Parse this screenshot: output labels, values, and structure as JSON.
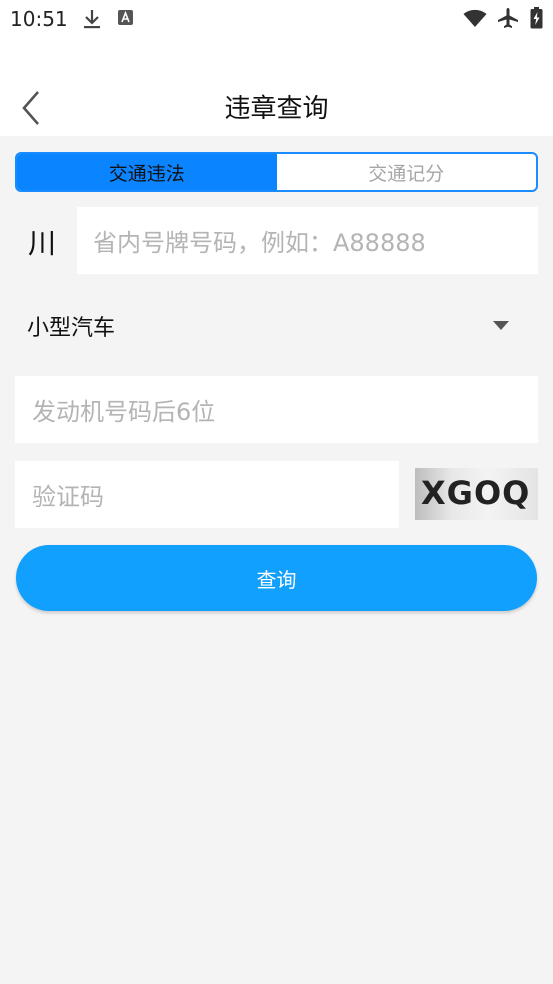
{
  "status_bar": {
    "time": "10:51",
    "left_icons": [
      "download-icon",
      "text-a-icon"
    ],
    "right_icons": [
      "wifi-icon",
      "airplane-icon",
      "battery-charging-icon"
    ]
  },
  "header": {
    "title": "违章查询",
    "back_icon": "chevron-left-icon"
  },
  "tabs": [
    {
      "label": "交通违法",
      "active": true
    },
    {
      "label": "交通记分",
      "active": false
    }
  ],
  "form": {
    "province_prefix": "川",
    "plate_placeholder": "省内号牌号码，例如：A88888",
    "vehicle_type": "小型汽车",
    "engine_placeholder": "发动机号码后6位",
    "captcha_placeholder": "验证码",
    "captcha_image_text": "XGOQ",
    "submit_label": "查询"
  },
  "colors": {
    "accent": "#0a84ff",
    "button": "#12a0ff",
    "background": "#f4f4f4"
  }
}
